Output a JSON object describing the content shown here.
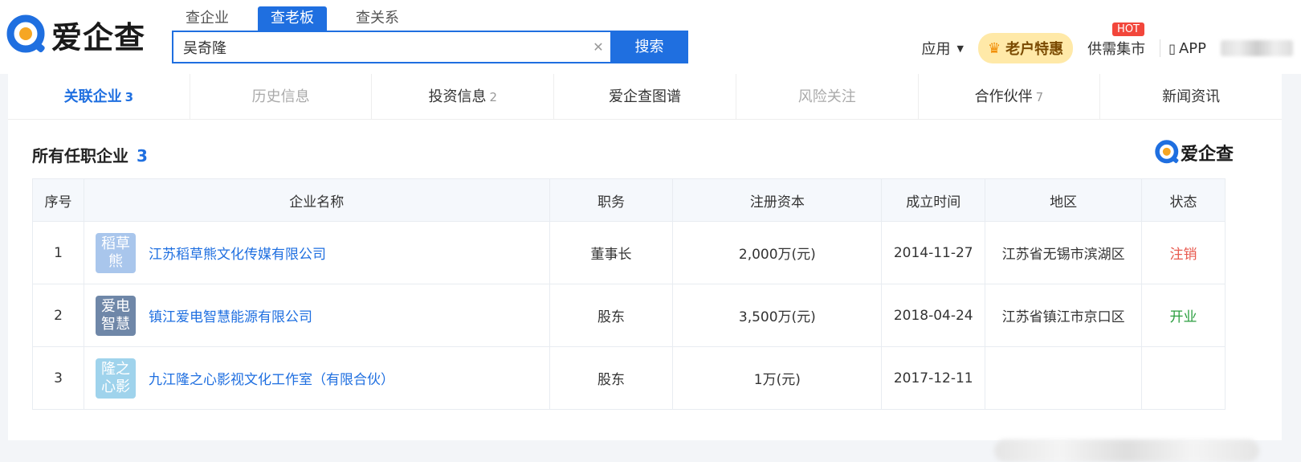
{
  "header": {
    "logo_text": "爱企查",
    "tabs": [
      "查企业",
      "查老板",
      "查关系"
    ],
    "active_tab": 1,
    "search_value": "吴奇隆",
    "search_button": "搜索",
    "nav": {
      "apps": "应用",
      "vip": "老户特惠",
      "market": "供需集市",
      "hot_badge": "HOT",
      "app": "APP"
    }
  },
  "subtabs": [
    {
      "label": "关联企业",
      "count": "3",
      "state": "active"
    },
    {
      "label": "历史信息",
      "count": "",
      "state": "disabled"
    },
    {
      "label": "投资信息",
      "count": "2",
      "state": "normal"
    },
    {
      "label": "爱企查图谱",
      "count": "",
      "state": "normal"
    },
    {
      "label": "风险关注",
      "count": "",
      "state": "disabled"
    },
    {
      "label": "合作伙伴",
      "count": "7",
      "state": "normal"
    },
    {
      "label": "新闻资讯",
      "count": "",
      "state": "normal"
    }
  ],
  "section": {
    "title": "所有任职企业",
    "count": "3",
    "watermark": "爱企查"
  },
  "table": {
    "headers": [
      "序号",
      "企业名称",
      "职务",
      "注册资本",
      "成立时间",
      "地区",
      "状态"
    ],
    "rows": [
      {
        "idx": "1",
        "logo": "稻草熊",
        "logo_color": "#a9c6ec",
        "name": "江苏稻草熊文化传媒有限公司",
        "role": "董事长",
        "capital": "2,000万(元)",
        "date": "2014-11-27",
        "region": "江苏省无锡市滨湖区",
        "status": "注销",
        "status_type": "cancel"
      },
      {
        "idx": "2",
        "logo": "爱电智慧",
        "logo_color": "#6f87a8",
        "name": "镇江爱电智慧能源有限公司",
        "role": "股东",
        "capital": "3,500万(元)",
        "date": "2018-04-24",
        "region": "江苏省镇江市京口区",
        "status": "开业",
        "status_type": "open"
      },
      {
        "idx": "3",
        "logo": "隆之心影",
        "logo_color": "#9fd3ec",
        "name": "九江隆之心影视文化工作室（有限合伙）",
        "role": "股东",
        "capital": "1万(元)",
        "date": "2017-12-11",
        "region": "",
        "status": "",
        "status_type": "cancel"
      }
    ]
  }
}
